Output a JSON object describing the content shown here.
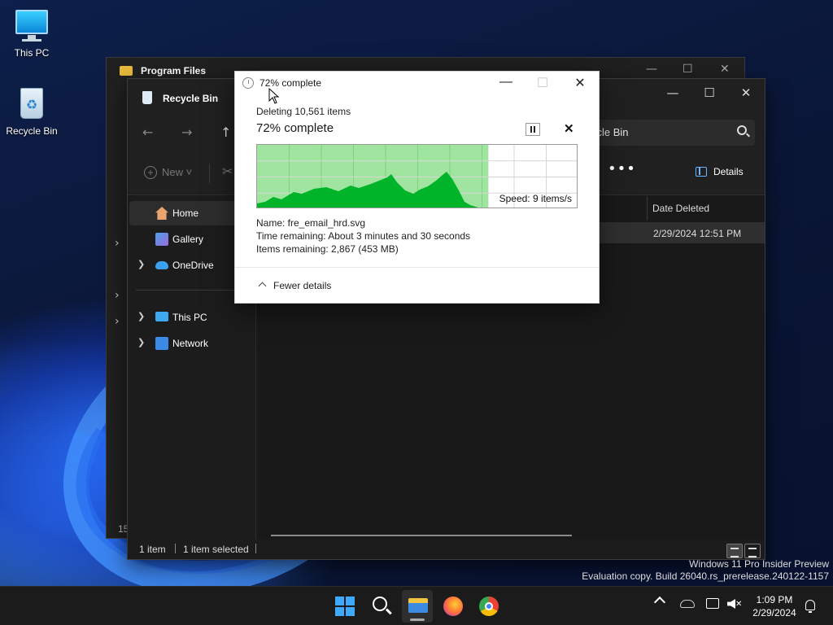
{
  "desktop": {
    "icons": [
      {
        "label": "This PC"
      },
      {
        "label": "Recycle Bin"
      }
    ]
  },
  "back_window": {
    "title": "Program Files",
    "status_count": "15"
  },
  "explorer": {
    "title": "Recycle Bin",
    "search_value": "ycle Bin",
    "toolbar": {
      "new_label": "New",
      "more_label": "•••",
      "details_label": "Details"
    },
    "sidebar": {
      "items": [
        {
          "label": "Home",
          "icon": "home-icon",
          "expandable": false,
          "selected": true
        },
        {
          "label": "Gallery",
          "icon": "gallery-icon",
          "expandable": false
        },
        {
          "label": "OneDrive",
          "icon": "onedrive-icon",
          "expandable": true
        },
        {
          "label": "This PC",
          "icon": "pc-icon",
          "expandable": true
        },
        {
          "label": "Network",
          "icon": "network-icon",
          "expandable": true
        }
      ]
    },
    "columns": {
      "date_deleted": "Date Deleted"
    },
    "rows": [
      {
        "date_deleted": "2/29/2024 12:51 PM"
      }
    ],
    "status": {
      "item_count": "1 item",
      "selected": "1 item selected"
    }
  },
  "progress_dialog": {
    "title": "72% complete",
    "deleting": "Deleting 10,561 items",
    "heading": "72% complete",
    "percent": 72,
    "speed": "Speed: 9 items/s",
    "name": "Name:  fre_email_hrd.svg",
    "time_remaining": "Time remaining:  About 3 minutes and 30 seconds",
    "items_remaining": "Items remaining:  2,867 (453 MB)",
    "fewer_details": "Fewer details",
    "colors": {
      "fill": "#00b42a",
      "progress_bg": "#9fe59f"
    }
  },
  "watermark": {
    "line1": "Windows 11 Pro Insider Preview",
    "line2": "Evaluation copy. Build 26040.rs_prerelease.240122-1157"
  },
  "taskbar": {
    "time": "1:09 PM",
    "date": "2/29/2024"
  }
}
